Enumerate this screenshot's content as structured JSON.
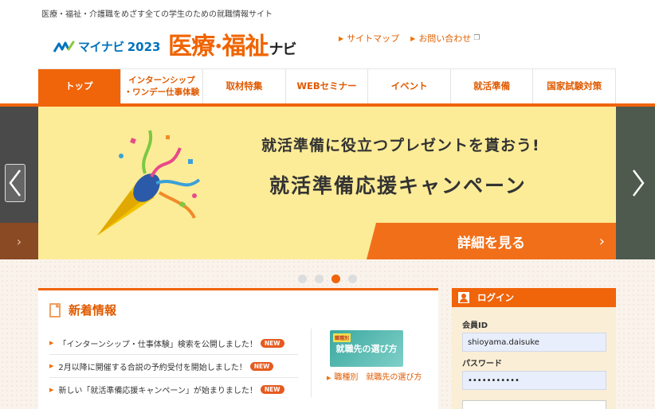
{
  "tagline": "医療・福祉・介護職をめざす全ての学生のための就職情報サイト",
  "logo": {
    "brand": "マイナビ",
    "year": "2023",
    "main": "医療·福祉",
    "suffix": "ナビ"
  },
  "util_links": [
    {
      "label": "サイトマップ"
    },
    {
      "label": "お問い合わせ"
    }
  ],
  "nav": [
    {
      "label": "トップ",
      "active": true
    },
    {
      "line1": "インターンシップ",
      "line2": "・ワンデー仕事体験"
    },
    {
      "label": "取材特集"
    },
    {
      "label": "WEBセミナー"
    },
    {
      "label": "イベント"
    },
    {
      "label": "就活準備"
    },
    {
      "label": "国家試験対策"
    }
  ],
  "banner": {
    "title1": "就活準備に役立つプレゼントを貰おう!",
    "title2": "就活準備応援キャンペーン",
    "cta": "詳細を見る",
    "cta_chevron": "›"
  },
  "carousel": {
    "slides": 4,
    "active_index": 2
  },
  "news": {
    "title": "新着情報",
    "new_badge": "NEW",
    "items": [
      {
        "text": "「インターンシップ・仕事体験」検索を公開しました！"
      },
      {
        "text": "2月以降に開催する合説の予約受付を開始しました！"
      },
      {
        "text": "新しい「就活準備応援キャンペーン」が始まりました！"
      }
    ],
    "feature": {
      "thumb_tag": "職種別",
      "thumb_title": "就職先の選び方",
      "link": "職種別　就職先の選び方"
    }
  },
  "login": {
    "title": "ログイン",
    "member_id_label": "会員ID",
    "member_id_value": "shioyama.daisuke",
    "password_label": "パスワード",
    "password_value": "•••••••••••"
  }
}
